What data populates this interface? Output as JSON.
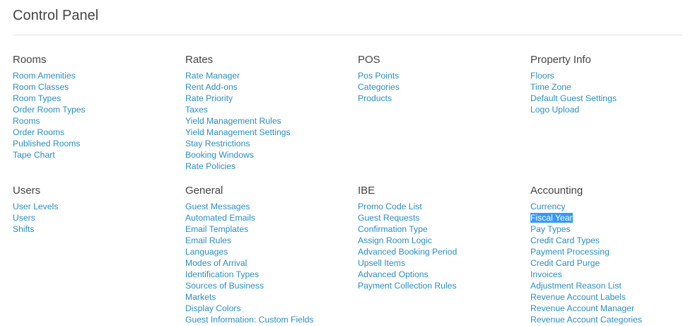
{
  "page": {
    "title": "Control Panel"
  },
  "colors": {
    "link": "#2a8fc4",
    "heading": "#444444",
    "selection": "#3399ff"
  },
  "sections": {
    "rooms": {
      "heading": "Rooms",
      "items": [
        "Room Amenities",
        "Room Classes",
        "Room Types",
        "Order Room Types",
        "Rooms",
        "Order Rooms",
        "Published Rooms",
        "Tape Chart"
      ]
    },
    "rates": {
      "heading": "Rates",
      "items": [
        "Rate Manager",
        "Rent Add-ons",
        "Rate Priority",
        "Taxes",
        "Yield Management Rules",
        "Yield Management Settings",
        "Stay Restrictions",
        "Booking Windows",
        "Rate Policies"
      ]
    },
    "pos": {
      "heading": "POS",
      "items": [
        "Pos Points",
        "Categories",
        "Products"
      ]
    },
    "property_info": {
      "heading": "Property Info",
      "items": [
        "Floors",
        "Time Zone",
        "Default Guest Settings",
        "Logo Upload"
      ]
    },
    "users": {
      "heading": "Users",
      "items": [
        "User Levels",
        "Users",
        "Shifts"
      ]
    },
    "general": {
      "heading": "General",
      "items": [
        "Guest Messages",
        "Automated Emails",
        "Email Templates",
        "Email Rules",
        "Languages",
        "Modes of Arrival",
        "Identification Types",
        "Sources of Business",
        "Markets",
        "Display Colors",
        "Guest Information: Custom Fields"
      ]
    },
    "ibe": {
      "heading": "IBE",
      "items": [
        "Promo Code List",
        "Guest Requests",
        "Confirmation Type",
        "Assign Room Logic",
        "Advanced Booking Period",
        "Upsell Items",
        "Advanced Options",
        "Payment Collection Rules"
      ]
    },
    "accounting": {
      "heading": "Accounting",
      "items": [
        "Currency",
        "Fiscal Year",
        "Pay Types",
        "Credit Card Types",
        "Payment Processing",
        "Credit Card Purge",
        "Invoices",
        "Adjustment Reason List",
        "Revenue Account Labels",
        "Revenue Account Manager",
        "Revenue Account Categories"
      ],
      "selected_index": 1
    }
  }
}
